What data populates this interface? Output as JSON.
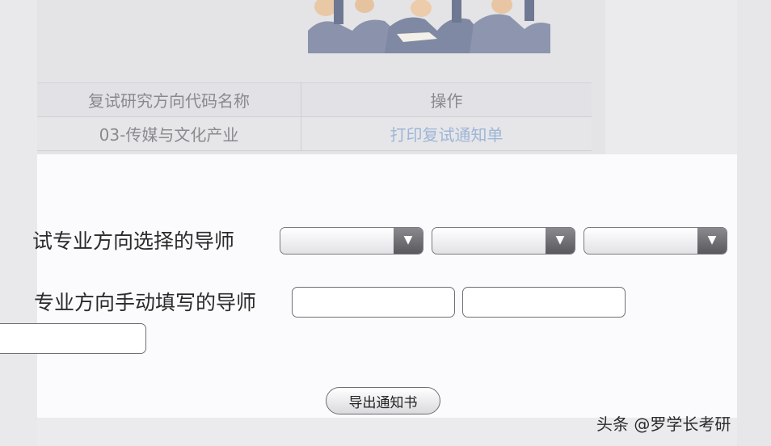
{
  "table": {
    "headers": [
      "复试研究方向代码名称",
      "操作"
    ],
    "rows": [
      {
        "direction": "03-传媒与文化产业",
        "action": "打印复试通知单"
      }
    ]
  },
  "form": {
    "select_label": "试专业方向选择的导师",
    "manual_label": "专业方向手动填写的导师",
    "selects": [
      {
        "value": ""
      },
      {
        "value": ""
      },
      {
        "value": ""
      }
    ],
    "inputs": [
      {
        "value": ""
      },
      {
        "value": ""
      },
      {
        "value": ""
      }
    ],
    "export_button": "导出通知书"
  },
  "icons": {
    "select_arrow": "caret-down-icon",
    "banner": "graduates-illustration"
  },
  "watermark": "头条 @罗学长考研",
  "colors": {
    "link": "#9eb6d6",
    "panel_bg": "#fbfbfd",
    "table_bg": "#e4e4e7"
  }
}
